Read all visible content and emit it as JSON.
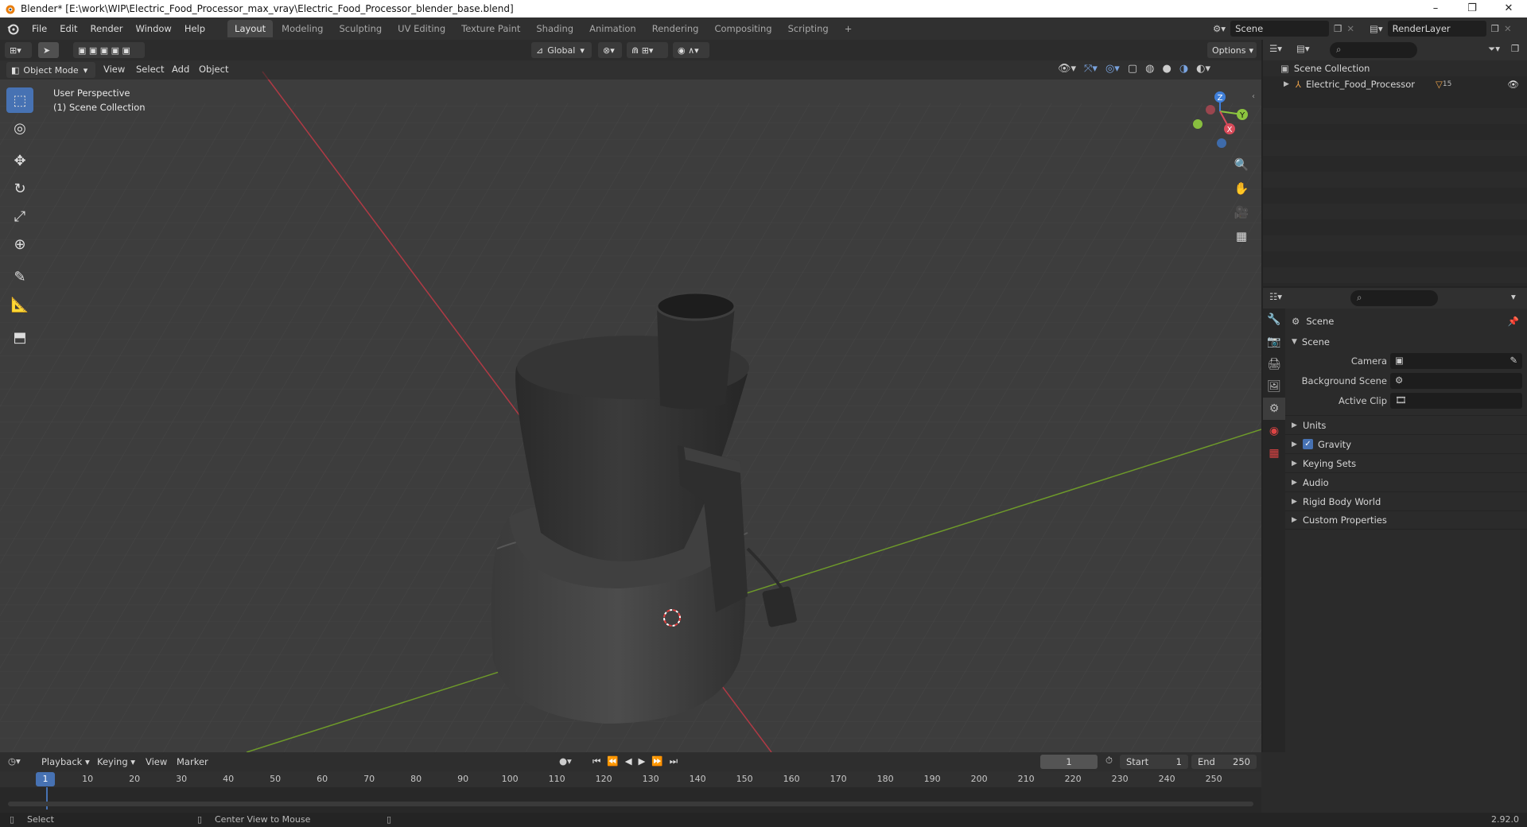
{
  "window": {
    "title": "Blender* [E:\\work\\WIP\\Electric_Food_Processor_max_vray\\Electric_Food_Processor_blender_base.blend]",
    "minimize": "–",
    "maximize": "❐",
    "close": "✕"
  },
  "menu": {
    "items": [
      "File",
      "Edit",
      "Render",
      "Window",
      "Help"
    ],
    "workspaces": [
      "Layout",
      "Modeling",
      "Sculpting",
      "UV Editing",
      "Texture Paint",
      "Shading",
      "Animation",
      "Rendering",
      "Compositing",
      "Scripting"
    ],
    "active_workspace": "Layout",
    "add_tab": "+",
    "scene_name": "Scene",
    "view_layer": "RenderLayer"
  },
  "viewport": {
    "mode": "Object Mode",
    "menus": [
      "View",
      "Select",
      "Add",
      "Object"
    ],
    "transform_orientation": "Global",
    "options_label": "Options",
    "overlay_title": "User Perspective",
    "overlay_subtitle": "(1) Scene Collection",
    "gizmo_axes": {
      "x": "X",
      "y": "Y",
      "z": "Z"
    }
  },
  "outliner": {
    "root": "Scene Collection",
    "items": [
      {
        "name": "Electric_Food_Processor",
        "badge": "15"
      }
    ]
  },
  "properties": {
    "context": "Scene",
    "panel_main": "Scene",
    "fields": [
      {
        "label": "Camera",
        "value": ""
      },
      {
        "label": "Background Scene",
        "value": ""
      },
      {
        "label": "Active Clip",
        "value": ""
      }
    ],
    "panels": [
      "Units",
      "Gravity",
      "Keying Sets",
      "Audio",
      "Rigid Body World",
      "Custom Properties"
    ],
    "gravity_checked": true
  },
  "timeline": {
    "menus": [
      "Playback",
      "Keying",
      "View",
      "Marker"
    ],
    "current_frame": "1",
    "start_label": "Start",
    "start_value": "1",
    "end_label": "End",
    "end_value": "250",
    "ruler": [
      "1",
      "10",
      "20",
      "30",
      "40",
      "50",
      "60",
      "70",
      "80",
      "90",
      "100",
      "110",
      "120",
      "130",
      "140",
      "150",
      "160",
      "170",
      "180",
      "190",
      "200",
      "210",
      "220",
      "230",
      "240",
      "250"
    ]
  },
  "statusbar": {
    "left": "Select",
    "middle": "Center View to Mouse",
    "version": "2.92.0"
  },
  "colors": {
    "accent": "#4772b3",
    "x_axis": "#d94b5a",
    "y_axis": "#8cc53f",
    "z_axis": "#3f7fd9"
  }
}
